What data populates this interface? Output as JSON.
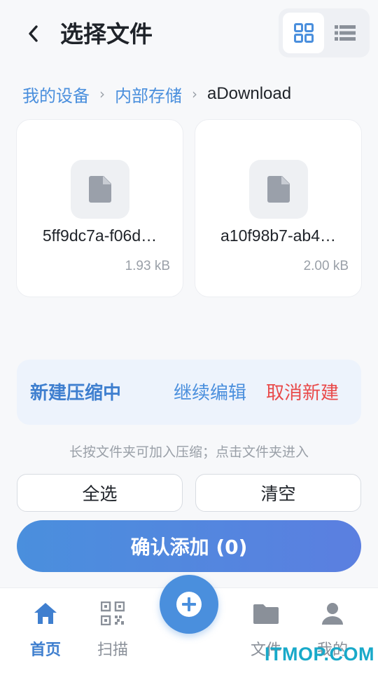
{
  "header": {
    "title": "选择文件",
    "back_icon": "chevron-left-icon",
    "view_modes": [
      {
        "icon": "grid-view-icon",
        "active": true
      },
      {
        "icon": "list-view-icon",
        "active": false
      }
    ]
  },
  "breadcrumb": [
    "我的设备",
    "内部存储",
    "aDownload"
  ],
  "files": [
    {
      "name": "5ff9dc7a-f06d…",
      "size": "1.93 kB",
      "icon": "file-icon"
    },
    {
      "name": "a10f98b7-ab4…",
      "size": "2.00 kB",
      "icon": "file-icon"
    }
  ],
  "banner": {
    "title": "新建压缩中",
    "continue_label": "继续编辑",
    "cancel_label": "取消新建"
  },
  "hint": "长按文件夹可加入压缩；点击文件夹进入",
  "actions": {
    "select_all": "全选",
    "clear": "清空",
    "confirm": "确认添加 (0)"
  },
  "nav": {
    "home": "首页",
    "scan": "扫描",
    "files": "文件",
    "mine": "我的"
  },
  "watermark": "ITMOP.COM",
  "colors": {
    "accent": "#4a8fdd",
    "danger": "#e94a4a",
    "background": "#f7f8fa"
  }
}
